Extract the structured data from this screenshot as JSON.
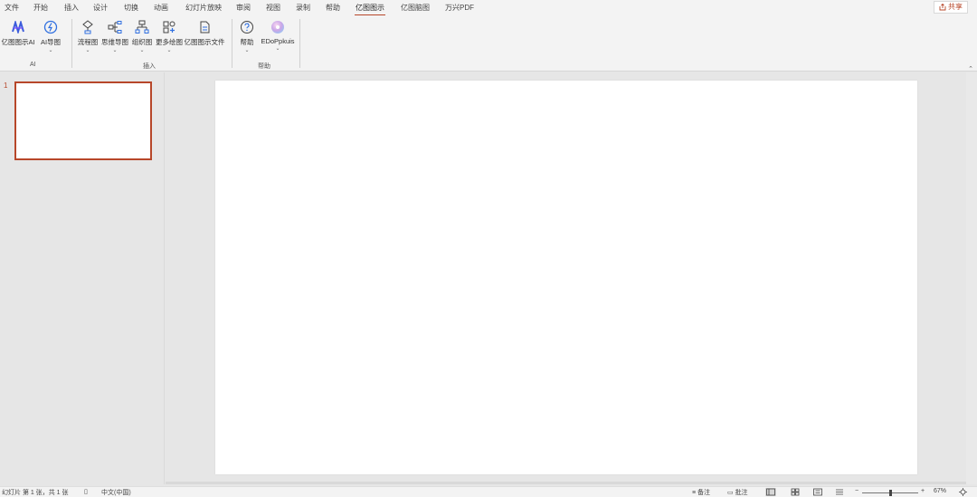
{
  "tabs": [
    {
      "label": "文件",
      "active": false
    },
    {
      "label": "开始",
      "active": false
    },
    {
      "label": "插入",
      "active": false
    },
    {
      "label": "设计",
      "active": false
    },
    {
      "label": "切换",
      "active": false
    },
    {
      "label": "动画",
      "active": false
    },
    {
      "label": "幻灯片放映",
      "active": false
    },
    {
      "label": "审阅",
      "active": false
    },
    {
      "label": "视图",
      "active": false
    },
    {
      "label": "录制",
      "active": false
    },
    {
      "label": "帮助",
      "active": false
    },
    {
      "label": "亿图图示",
      "active": true
    },
    {
      "label": "亿图脑图",
      "active": false
    },
    {
      "label": "万兴PDF",
      "active": false
    }
  ],
  "share": {
    "label": "共享",
    "icon": "share-icon"
  },
  "ribbon": {
    "groups": [
      {
        "label": "AI",
        "buttons": [
          {
            "label": "亿图图示AI",
            "icon": "ai-logo-icon",
            "dropdown": false
          },
          {
            "label": "AI导图",
            "icon": "ai-sparkle-icon",
            "dropdown": true
          }
        ]
      },
      {
        "label": "插入",
        "buttons": [
          {
            "label": "流程图",
            "icon": "flowchart-icon",
            "dropdown": true
          },
          {
            "label": "思维导图",
            "icon": "mindmap-icon",
            "dropdown": true
          },
          {
            "label": "组织图",
            "icon": "orgchart-icon",
            "dropdown": true
          },
          {
            "label": "更多绘图",
            "icon": "more-diagrams-icon",
            "dropdown": true
          },
          {
            "label": "亿图图示文件",
            "icon": "edraw-file-icon",
            "dropdown": false
          }
        ]
      },
      {
        "label": "帮助",
        "buttons": [
          {
            "label": "帮助",
            "icon": "help-icon",
            "dropdown": true
          },
          {
            "label": "EDoPpkuis",
            "icon": "plugin-disc-icon",
            "dropdown": true
          }
        ]
      }
    ]
  },
  "slide_pane": {
    "slide_number": "1"
  },
  "status": {
    "slide_info": "幻灯片 第 1 张，共 1 张",
    "language": "中文(中国)",
    "notes": "备注",
    "comments": "批注",
    "zoom": "67%"
  },
  "colors": {
    "accent": "#b7472a",
    "ribbon_bg": "#f3f3f3",
    "workspace_bg": "#e6e6e6"
  }
}
